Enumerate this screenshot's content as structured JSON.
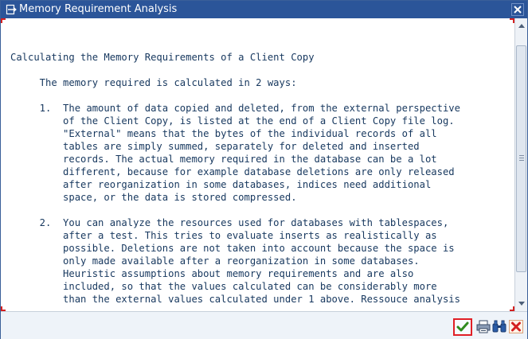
{
  "window": {
    "title": "Memory Requirement Analysis"
  },
  "document": {
    "text": "Calculating the Memory Requirements of a Client Copy\n\n     The memory required is calculated in 2 ways:\n\n     1.  The amount of data copied and deleted, from the external perspective\n         of the Client Copy, is listed at the end of a Client Copy file log.\n         \"External\" means that the bytes of the individual records of all\n         tables are simply summed, separately for deleted and inserted\n         records. The actual memory required in the database can be a lot\n         different, because for example database deletions are only released\n         after reorganization in some databases, indices need additional\n         space, or the data is stored compressed.\n\n     2.  You can analyze the resources used for databases with tablespaces,\n         after a test. This tries to evaluate inserts as realistically as\n         possible. Deletions are not taken into account because the space is\n         only made available after a reorganization in some databases.\n         Heuristic assumptions about memory requirements and are also\n         included, so that the values calculated can be considerably more\n         than the external values calculated under 1 above. Ressouce analysis"
  },
  "icons": {
    "title": "document-arrow-icon",
    "close": "close-icon",
    "scroll_up": "arrow-up-icon",
    "scroll_down": "arrow-down-icon",
    "confirm": "checkmark-icon",
    "print": "printer-icon",
    "find": "binoculars-icon",
    "cancel": "cancel-x-icon"
  },
  "colors": {
    "titlebar": "#2b5599",
    "text": "#16375e",
    "confirm_check": "#2e8b1f",
    "cancel": "#d42020",
    "focus_border": "#e01f26"
  }
}
